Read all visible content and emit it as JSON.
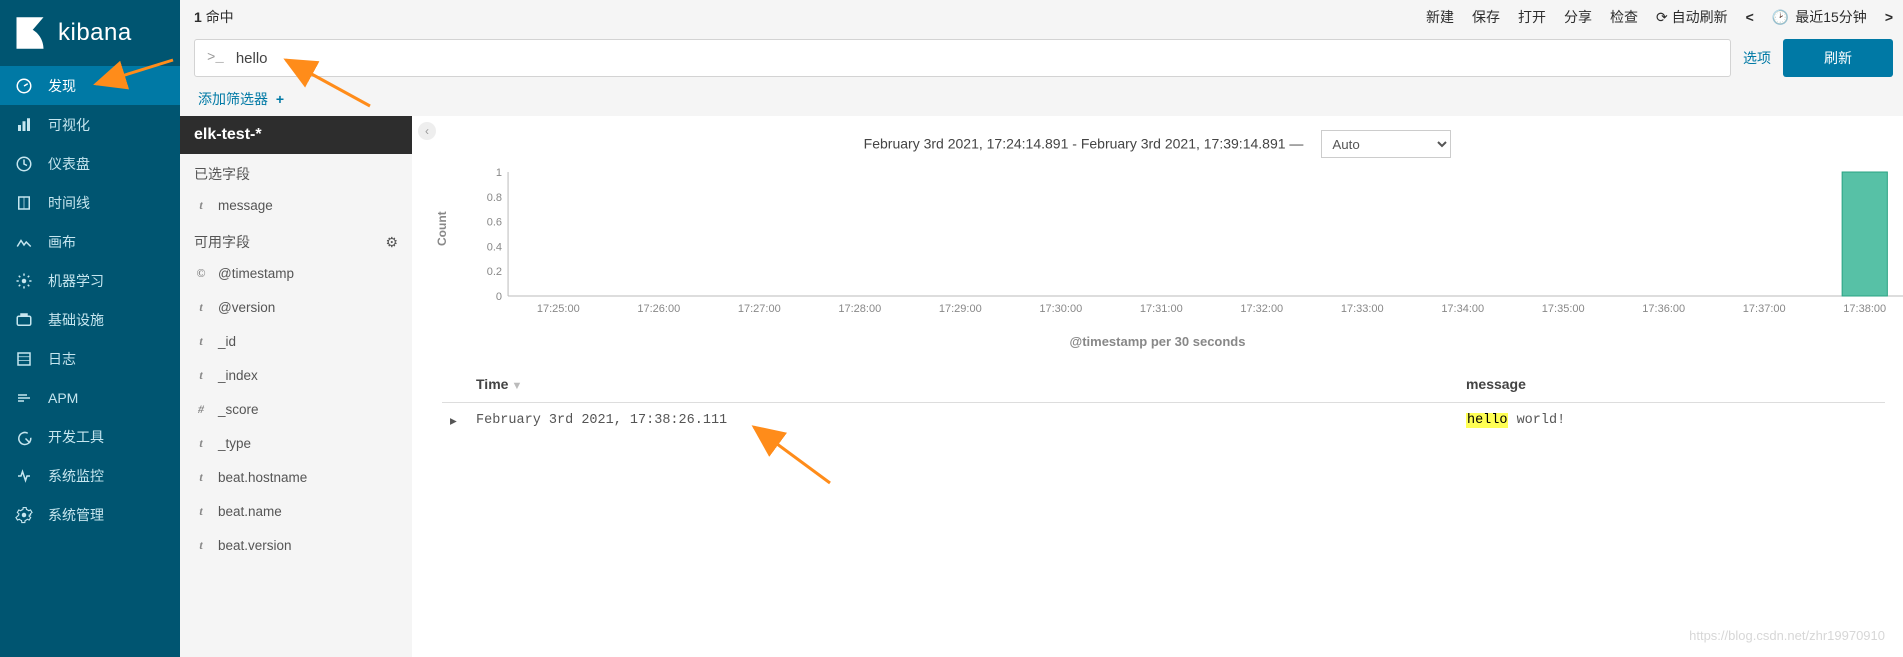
{
  "brand": "kibana",
  "sidebar": {
    "items": [
      {
        "label": "发现",
        "active": true
      },
      {
        "label": "可视化"
      },
      {
        "label": "仪表盘"
      },
      {
        "label": "时间线"
      },
      {
        "label": "画布"
      },
      {
        "label": "机器学习"
      },
      {
        "label": "基础设施"
      },
      {
        "label": "日志"
      },
      {
        "label": "APM"
      },
      {
        "label": "开发工具"
      },
      {
        "label": "系统监控"
      },
      {
        "label": "系统管理"
      }
    ]
  },
  "top": {
    "hits_count": "1",
    "hits_label": "命中",
    "menu": [
      "新建",
      "保存",
      "打开",
      "分享",
      "检查"
    ],
    "auto_refresh": "自动刷新",
    "time_label": "最近15分钟"
  },
  "query": {
    "prompt": ">_",
    "value": "hello",
    "options": "选项",
    "refresh": "刷新"
  },
  "filters": {
    "add_label": "添加筛选器"
  },
  "fields": {
    "index_pattern": "elk-test-*",
    "selected_header": "已选字段",
    "available_header": "可用字段",
    "selected": [
      {
        "type": "t",
        "name": "message"
      }
    ],
    "available": [
      {
        "type": "©",
        "name": "@timestamp"
      },
      {
        "type": "t",
        "name": "@version"
      },
      {
        "type": "t",
        "name": "_id"
      },
      {
        "type": "t",
        "name": "_index"
      },
      {
        "type": "#",
        "name": "_score"
      },
      {
        "type": "t",
        "name": "_type"
      },
      {
        "type": "t",
        "name": "beat.hostname"
      },
      {
        "type": "t",
        "name": "beat.name"
      },
      {
        "type": "t",
        "name": "beat.version"
      }
    ]
  },
  "main": {
    "time_range": "February 3rd 2021, 17:24:14.891 - February 3rd 2021, 17:39:14.891 —",
    "interval": "Auto",
    "xlabel": "@timestamp per 30 seconds",
    "ylabel": "Count",
    "columns": {
      "time": "Time",
      "message": "message"
    },
    "rows": [
      {
        "time": "February 3rd 2021, 17:38:26.111",
        "message_hl": "hello",
        "message_rest": " world!"
      }
    ]
  },
  "chart_data": {
    "type": "bar",
    "title": "",
    "xlabel": "@timestamp per 30 seconds",
    "ylabel": "Count",
    "ylim": [
      0,
      1
    ],
    "yticks": [
      0,
      0.2,
      0.4,
      0.6,
      0.8,
      1
    ],
    "categories": [
      "17:25:00",
      "17:26:00",
      "17:27:00",
      "17:28:00",
      "17:29:00",
      "17:30:00",
      "17:31:00",
      "17:32:00",
      "17:33:00",
      "17:34:00",
      "17:35:00",
      "17:36:00",
      "17:37:00",
      "17:38:00"
    ],
    "series": [
      {
        "name": "Count",
        "color": "#57c1a6",
        "values": [
          0,
          0,
          0,
          0,
          0,
          0,
          0,
          0,
          0,
          0,
          0,
          0,
          0,
          1
        ]
      }
    ]
  },
  "watermark": "https://blog.csdn.net/zhr19970910"
}
